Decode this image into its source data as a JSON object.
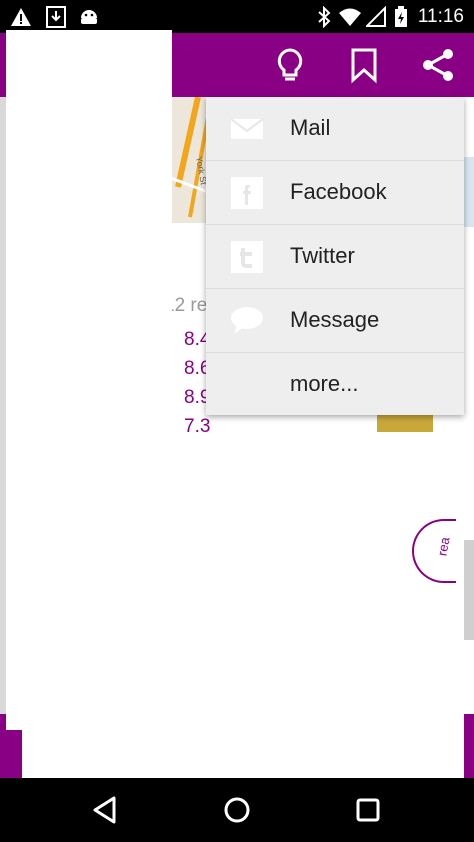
{
  "status_bar": {
    "time": "11:16",
    "left_icons": [
      "notification-alert-icon",
      "download-icon",
      "android-icon"
    ],
    "right_icons": [
      "bluetooth-icon",
      "wifi-icon",
      "signal-icon",
      "battery-charging-icon"
    ]
  },
  "toolbar": {
    "color": "#8a0085",
    "actions": [
      "lightbulb-icon",
      "bookmark-icon",
      "share-icon"
    ]
  },
  "background": {
    "reviews_text": "12 rev",
    "scores": [
      "8.4",
      "8.6",
      "8.9",
      "7.3"
    ],
    "map_label": "York St",
    "round_button_text": "rea"
  },
  "share_menu": {
    "items": [
      {
        "label": "Mail",
        "icon": "mail-icon"
      },
      {
        "label": "Facebook",
        "icon": "facebook-icon"
      },
      {
        "label": "Twitter",
        "icon": "twitter-icon"
      },
      {
        "label": "Message",
        "icon": "message-icon"
      },
      {
        "label": "more...",
        "icon": ""
      }
    ]
  },
  "nav_bar": {
    "buttons": [
      "back-icon",
      "home-icon",
      "recents-icon"
    ]
  }
}
